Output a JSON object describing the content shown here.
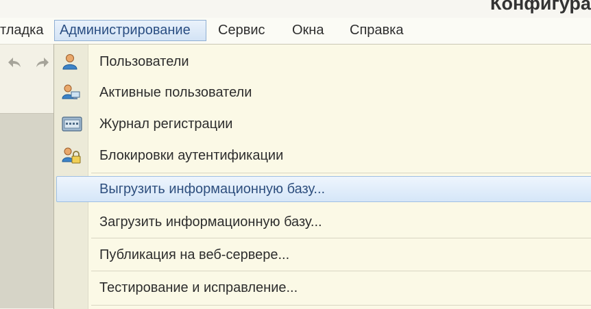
{
  "window": {
    "title": "Конфигура"
  },
  "menubar": {
    "items": [
      {
        "label": "тладка"
      },
      {
        "label": "Администрирование"
      },
      {
        "label": "Сервис"
      },
      {
        "label": "Окна"
      },
      {
        "label": "Справка"
      }
    ]
  },
  "toolbar": {
    "back_icon": "arrow-back-icon",
    "forward_icon": "arrow-forward-icon"
  },
  "dropdown": {
    "items": [
      {
        "label": "Пользователи",
        "icon": "user-icon"
      },
      {
        "label": "Активные пользователи",
        "icon": "active-users-icon"
      },
      {
        "label": "Журнал регистрации",
        "icon": "log-journal-icon"
      },
      {
        "label": "Блокировки аутентификации",
        "icon": "user-lock-icon"
      },
      {
        "label": "Выгрузить информационную базу..."
      },
      {
        "label": "Загрузить информационную базу..."
      },
      {
        "label": "Публикация на веб-сервере..."
      },
      {
        "label": "Тестирование и исправление..."
      }
    ],
    "highlighted_index": 4
  }
}
